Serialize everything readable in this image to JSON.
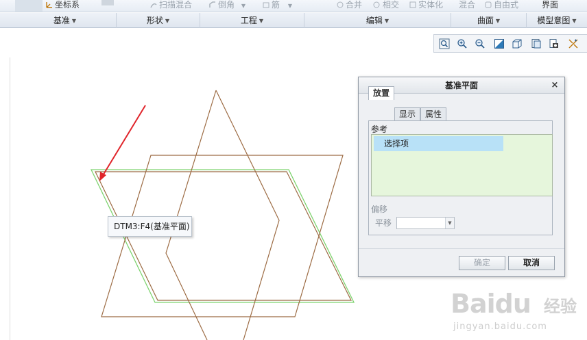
{
  "ribbon": {
    "top_items": [
      {
        "label": "坐标系",
        "icon": "coordinate-system-icon",
        "dim": false
      },
      {
        "label": "扫描混合",
        "icon": "swept-blend-icon",
        "dim": true
      },
      {
        "label": "倒角",
        "icon": "chamfer-icon",
        "dim": true
      },
      {
        "label": "筋",
        "icon": "rib-icon",
        "dim": true
      },
      {
        "label": "合并",
        "icon": "merge-icon",
        "dim": true
      },
      {
        "label": "相交",
        "icon": "intersect-icon",
        "dim": true
      },
      {
        "label": "实体化",
        "icon": "solidify-icon",
        "dim": true
      },
      {
        "label": "混合",
        "icon": "blend-icon",
        "dim": true
      },
      {
        "label": "自由式",
        "icon": "freestyle-icon",
        "dim": true
      },
      {
        "label": "界面",
        "icon": "interface-icon",
        "dim": false
      }
    ],
    "groups": [
      {
        "label": "基准"
      },
      {
        "label": "形状"
      },
      {
        "label": "工程"
      },
      {
        "label": "编辑"
      },
      {
        "label": "曲面"
      },
      {
        "label": "模型意图"
      }
    ]
  },
  "view_toolbar": {
    "buttons": [
      "refit-icon",
      "zoom-in-icon",
      "zoom-out-icon",
      "repaint-icon",
      "saved-views-icon",
      "named-views-icon",
      "display-style-icon",
      "datum-display-icon"
    ]
  },
  "graphics": {
    "tooltip": "DTM3:F4(基准平面)",
    "colors": {
      "sketch_lines": "#9c6b43",
      "highlight": "#7ed36f",
      "arrow": "#e0242a"
    }
  },
  "dialog": {
    "title": "基准平面",
    "close": "×",
    "tabs": [
      {
        "label": "放置",
        "active": true
      },
      {
        "label": "显示",
        "active": false
      },
      {
        "label": "属性",
        "active": false
      }
    ],
    "references_label": "参考",
    "reference_item": "选择项",
    "offset_label": "偏移",
    "translate_label": "平移",
    "offset_value": "",
    "ok_label": "确定",
    "cancel_label": "取消"
  },
  "watermark": {
    "logo": "Baidu",
    "logo_suffix": "经验",
    "url": "jingyan.baidu.com"
  }
}
